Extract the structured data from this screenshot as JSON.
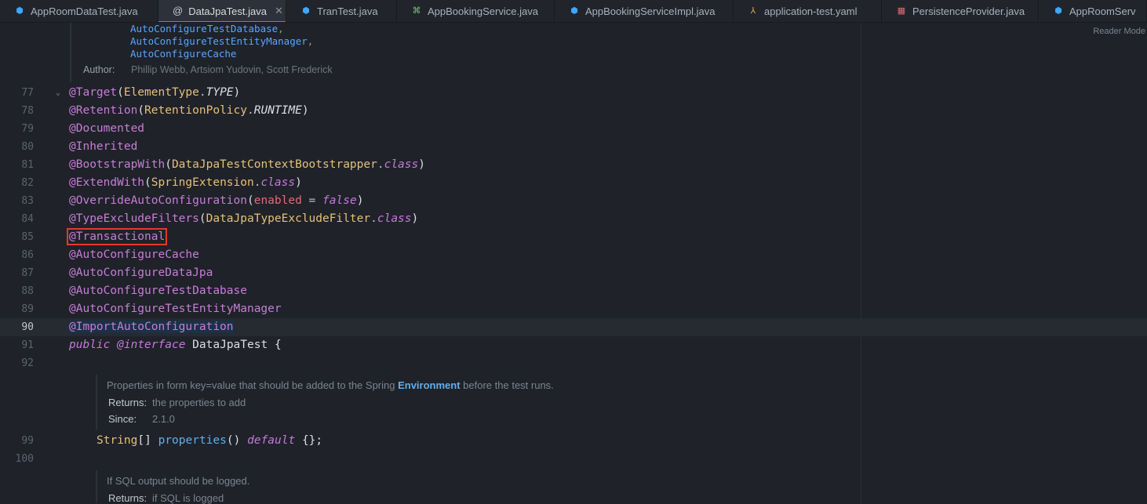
{
  "tabs": [
    {
      "label": "AppRoomDataTest.java",
      "icon": "class-icon",
      "active": false
    },
    {
      "label": "DataJpaTest.java",
      "icon": "annotation-icon",
      "active": true
    },
    {
      "label": "TranTest.java",
      "icon": "class-icon",
      "active": false
    },
    {
      "label": "AppBookingService.java",
      "icon": "interface-icon",
      "active": false
    },
    {
      "label": "AppBookingServiceImpl.java",
      "icon": "class-icon",
      "active": false
    },
    {
      "label": "application-test.yaml",
      "icon": "yaml-icon",
      "active": false
    },
    {
      "label": "PersistenceProvider.java",
      "icon": "package-icon",
      "active": false
    },
    {
      "label": "AppRoomServ",
      "icon": "class-icon",
      "active": false
    }
  ],
  "reader_mode_label": "Reader Mode",
  "doc_top": {
    "see_items": [
      "AutoConfigureTestDatabase",
      "AutoConfigureTestEntityManager",
      "AutoConfigureCache"
    ],
    "author_label": "Author:",
    "author_value": "Phillip Webb, Artsiom Yudovin, Scott Frederick"
  },
  "lines": {
    "l77": {
      "num": "77",
      "a": "@Target",
      "b": "(",
      "c": "ElementType",
      "d": ".",
      "e": "TYPE",
      "f": ")"
    },
    "l78": {
      "num": "78",
      "a": "@Retention",
      "b": "(",
      "c": "RetentionPolicy",
      "d": ".",
      "e": "RUNTIME",
      "f": ")"
    },
    "l79": {
      "num": "79",
      "a": "@Documented"
    },
    "l80": {
      "num": "80",
      "a": "@Inherited"
    },
    "l81": {
      "num": "81",
      "a": "@BootstrapWith",
      "b": "(",
      "c": "DataJpaTestContextBootstrapper",
      "d": ".",
      "e": "class",
      "f": ")"
    },
    "l82": {
      "num": "82",
      "a": "@ExtendWith",
      "b": "(",
      "c": "SpringExtension",
      "d": ".",
      "e": "class",
      "f": ")"
    },
    "l83": {
      "num": "83",
      "a": "@OverrideAutoConfiguration",
      "b": "(",
      "c": "enabled",
      "d": " = ",
      "e": "false",
      "f": ")"
    },
    "l84": {
      "num": "84",
      "a": "@TypeExcludeFilters",
      "b": "(",
      "c": "DataJpaTypeExcludeFilter",
      "d": ".",
      "e": "class",
      "f": ")"
    },
    "l85": {
      "num": "85",
      "a": "@Transactional"
    },
    "l86": {
      "num": "86",
      "a": "@AutoConfigureCache"
    },
    "l87": {
      "num": "87",
      "a": "@AutoConfigureDataJpa"
    },
    "l88": {
      "num": "88",
      "a": "@AutoConfigureTestDatabase"
    },
    "l89": {
      "num": "89",
      "a": "@AutoConfigureTestEntityManager"
    },
    "l90": {
      "num": "90",
      "a": "@ImportAutoConfiguration"
    },
    "l91": {
      "num": "91",
      "a": "public",
      "b": " ",
      "c": "@interface",
      "d": " DataJpaTest ",
      "e": "{"
    },
    "l92": {
      "num": "92"
    },
    "l99": {
      "num": "99",
      "a": "String",
      "b": "[]",
      "c": " ",
      "d": "properties",
      "e": "()",
      "f": " ",
      "g": "default",
      "h": " {};"
    },
    "l100": {
      "num": "100"
    }
  },
  "doc_properties": {
    "text_before": "Properties in form key=value that should be added to the Spring ",
    "link": "Environment",
    "text_after": " before the test runs.",
    "returns_label": "Returns:",
    "returns_value": "the properties to add",
    "since_label": "Since:",
    "since_value": "2.1.0"
  },
  "doc_sql": {
    "text": "If SQL output should be logged.",
    "returns_label": "Returns:",
    "returns_value": "if SQL is logged"
  },
  "colors": {
    "accent": "#4e86e0",
    "highlight_box": "#e5382c",
    "annotation": "#c77dd7",
    "type": "#e5c07b"
  }
}
